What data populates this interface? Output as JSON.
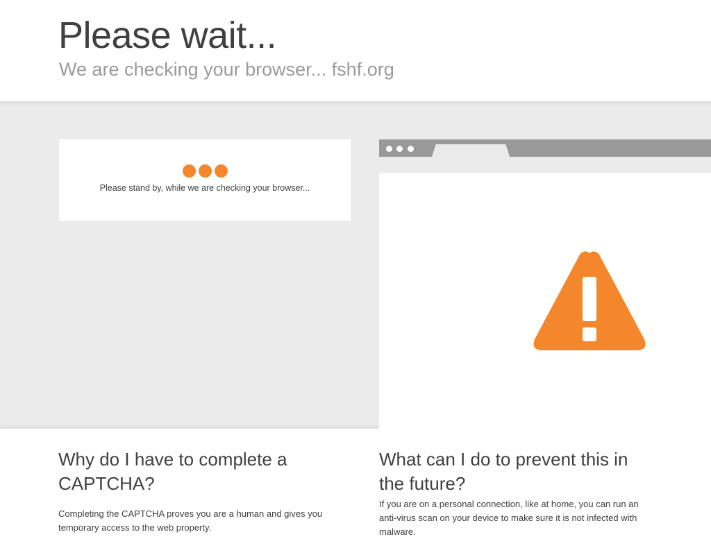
{
  "header": {
    "title": "Please wait...",
    "subtitle": "We are checking your browser... fshf.org"
  },
  "status_card": {
    "text": "Please stand by, while we are checking your browser...",
    "loader_icon": "three-dots-loader-icon"
  },
  "illustration": {
    "browser_icon": "browser-window-icon",
    "warning_icon": "warning-triangle-icon"
  },
  "faq": {
    "left": {
      "heading": "Why do I have to complete a CAPTCHA?",
      "body": "Completing the CAPTCHA proves you are a human and gives you temporary access to the web property."
    },
    "right": {
      "heading": "What can I do to prevent this in the future?",
      "body": "If you are on a personal connection, like at home, you can run an anti-virus scan on your device to make sure it is not infected with malware."
    }
  },
  "colors": {
    "accent_orange": "#f4872b",
    "band_gray": "#ebebeb",
    "browser_gray": "#999999",
    "text_dark": "#404040",
    "text_light": "#9a9a9a"
  }
}
